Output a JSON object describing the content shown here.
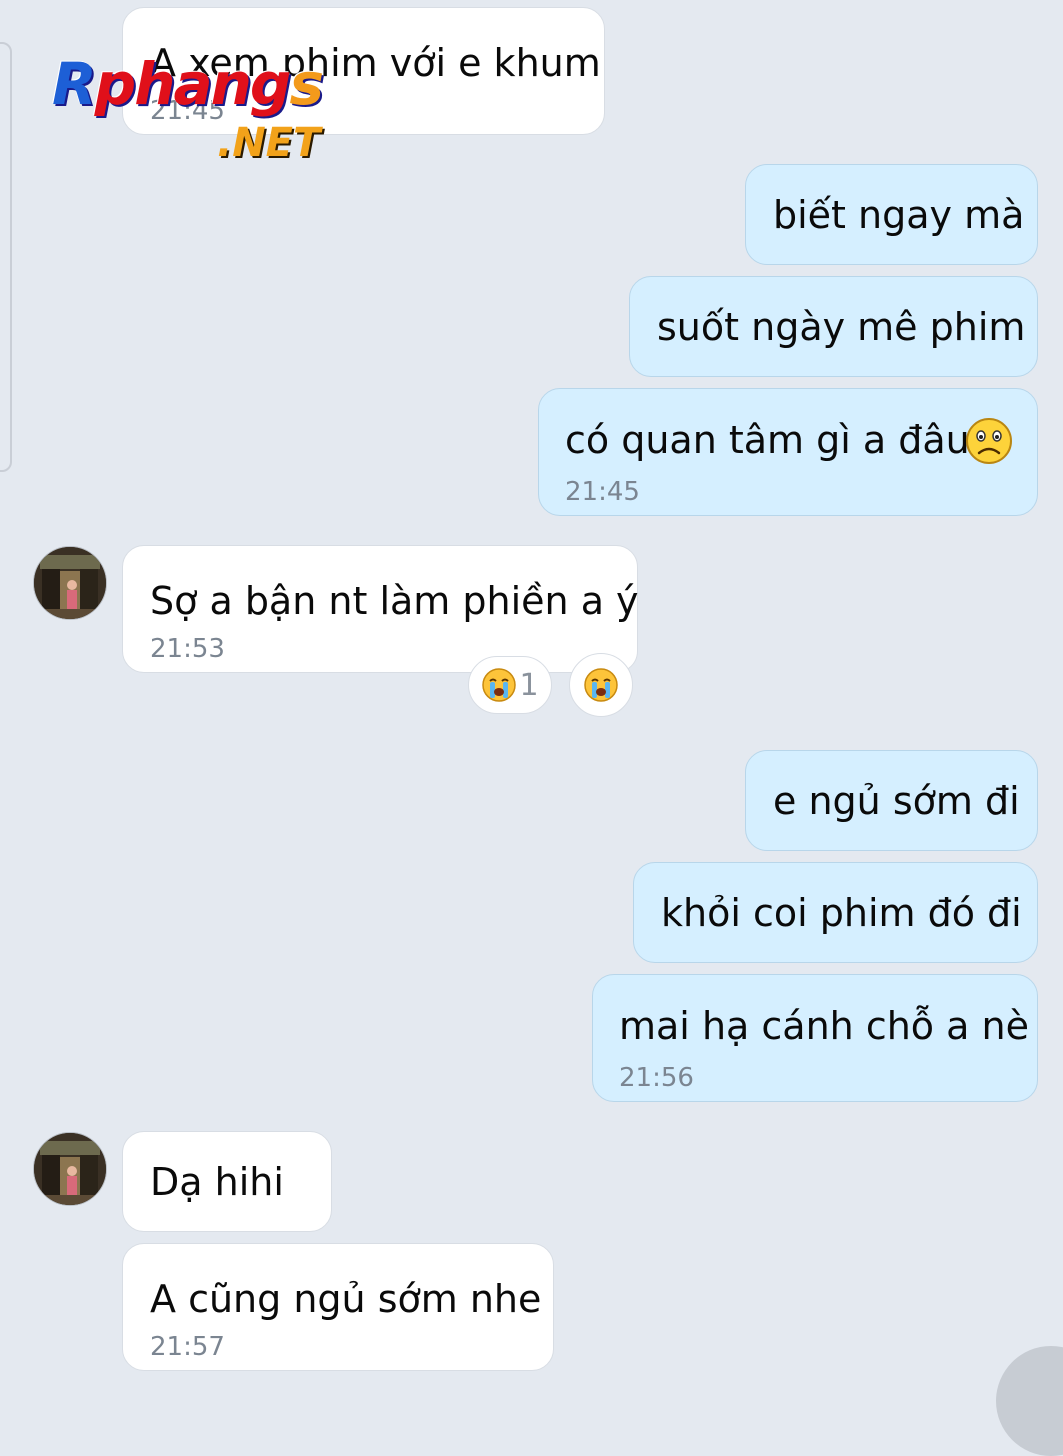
{
  "watermark": {
    "brand": "Rphangs",
    "domain": ".NET"
  },
  "messages": [
    {
      "side": "in",
      "text": "A xem phim với e khum",
      "time": "21:45"
    },
    {
      "side": "out",
      "text": "biết ngay mà"
    },
    {
      "side": "out",
      "text": "suốt ngày mê phim"
    },
    {
      "side": "out",
      "text": "có quan tâm gì a đâu",
      "emoji": "sad-face",
      "time": "21:45"
    },
    {
      "side": "in",
      "text": "Sợ a bận nt làm phiền a ý",
      "time": "21:53",
      "reactions": [
        {
          "icon": "crying-face",
          "count": "1"
        },
        {
          "icon": "crying-face",
          "count": ""
        }
      ]
    },
    {
      "side": "out",
      "text": "e ngủ sớm đi"
    },
    {
      "side": "out",
      "text": "khỏi coi phim đó đi"
    },
    {
      "side": "out",
      "text": "mai hạ cánh chỗ a nè",
      "time": "21:56"
    },
    {
      "side": "in",
      "text": "Dạ hihi"
    },
    {
      "side": "in",
      "text": "A cũng ngủ sớm nhe",
      "time": "21:57"
    }
  ],
  "colors": {
    "background": "#e4e9f0",
    "incoming_bubble": "#ffffff",
    "outgoing_bubble": "#d5efff",
    "timestamp": "#7b8591"
  }
}
